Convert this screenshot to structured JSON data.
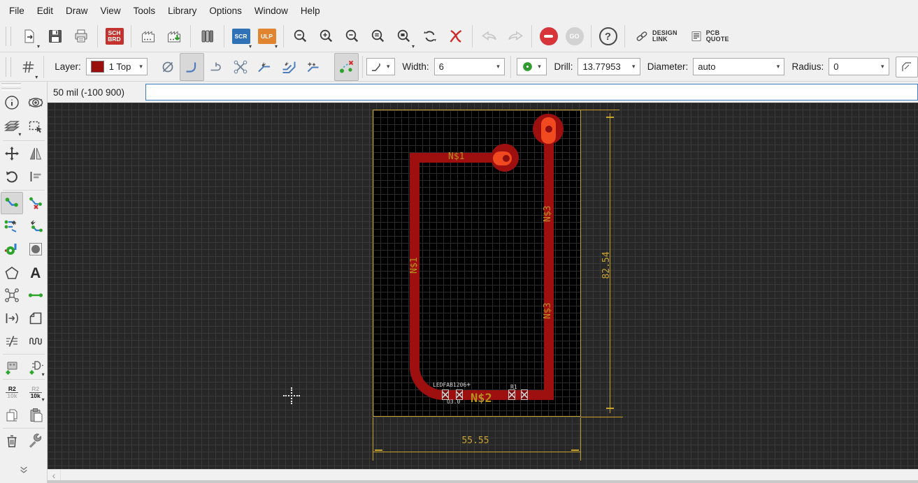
{
  "menu": {
    "items": [
      "File",
      "Edit",
      "Draw",
      "View",
      "Tools",
      "Library",
      "Options",
      "Window",
      "Help"
    ]
  },
  "toolbar": {
    "schbrd_top": "SCH",
    "schbrd_bottom": "BRD",
    "scr": "SCR",
    "ulp": "ULP",
    "go": "GO",
    "help": "?",
    "design_link_line1": "DESIGN",
    "design_link_line2": "LINK",
    "pcb_quote_line1": "PCB",
    "pcb_quote_line2": "QUOTE"
  },
  "params": {
    "layer_label": "Layer:",
    "layer_value": "1 Top",
    "width_label": "Width:",
    "width_value": "6",
    "drill_label": "Drill:",
    "drill_value": "13.77953",
    "diameter_label": "Diameter:",
    "diameter_value": "auto",
    "radius_label": "Radius:",
    "radius_value": "0"
  },
  "status": {
    "coordinates": "50 mil (-100 900)",
    "command_value": ""
  },
  "sidebar": {
    "name_top": "R2",
    "name_bottom": "10k",
    "value_top": "R2",
    "value_bottom": "10k",
    "text_tool": "A"
  },
  "icons": {
    "caret": "▾",
    "scroll_left": "‹"
  },
  "canvas": {
    "net_labels": [
      {
        "text": "N$1",
        "position": "top-trace"
      },
      {
        "text": "N$1",
        "position": "left-trace-vertical"
      },
      {
        "text": "N$3",
        "position": "right-trace-upper-vertical"
      },
      {
        "text": "N$3",
        "position": "right-trace-lower-vertical"
      },
      {
        "text": "N$2",
        "position": "bottom-trace"
      }
    ],
    "dimension_height": "82.54",
    "dimension_width": "55.55",
    "silk_part": "LEDFAB1206",
    "silk_origin": "+",
    "silk_name": "U3.0",
    "silk_ref": "R1",
    "colors": {
      "trace": "#9e1010",
      "pad_hot": "#f14a20",
      "dimension": "#c9a42d",
      "net_label": "#b8901e",
      "board_bg": "#000000",
      "canvas_bg": "#272727",
      "layer_swatch": "#9b0e0e"
    }
  }
}
